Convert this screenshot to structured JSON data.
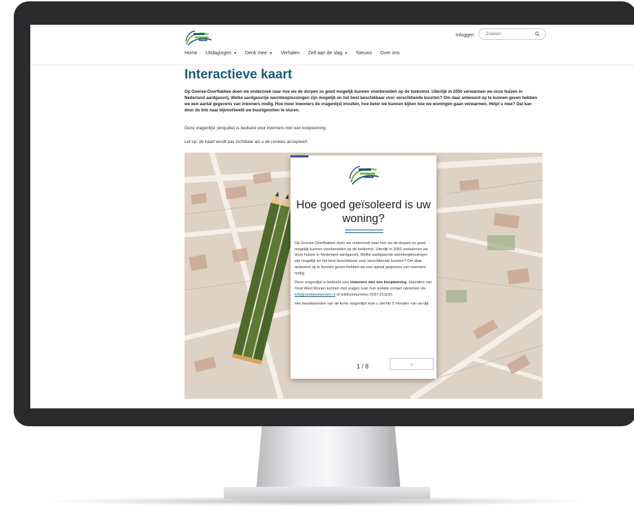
{
  "header": {
    "login_label": "Inloggen",
    "search_placeholder": "Zoeken"
  },
  "nav": {
    "items": [
      {
        "label": "Home",
        "dropdown": false
      },
      {
        "label": "Uitdagingen",
        "dropdown": true
      },
      {
        "label": "Denk mee",
        "dropdown": true
      },
      {
        "label": "Verhalen",
        "dropdown": false
      },
      {
        "label": "Zelf aan de slag",
        "dropdown": true
      },
      {
        "label": "Nieuws",
        "dropdown": false
      },
      {
        "label": "Over ons",
        "dropdown": false
      }
    ]
  },
  "page": {
    "title": "Interactieve kaart",
    "intro": "Op Goeree-Overflakkee doen we onderzoek naar hoe we de dorpen zo goed mogelijk kunnen voorbereiden op de toekomst. Uiterlijk in 2050 verwarmen we onze huizen in Nederland aardgasvrij. Welke aardgasvrije warmteoplossingen zijn mogelijk en het best beschikbaar voor verschillende buurten? Om daar antwoord op te kunnen geven hebben we een aantal gegevens van inwoners nodig. Hoe meer inwoners de vragenlijst invullen, hoe beter we kunnen kijken hoe we woningen gaan verwarmen. Helpt u mee? Dat kan door de link naar bijvoorbeeld uw buurtgenoten te sturen.",
    "note": "Deze vragenlijst (enquête) is bedoeld voor inwoners met een koopwoning.",
    "cookie_note": "Let op: de kaart wordt pas zichtbaar als u de cookies accepteert."
  },
  "card": {
    "title": "Hoe goed geïsoleerd is uw woning?",
    "p1": "Op Goeree-Overflakkee doen we onderzoek naar hoe we de dorpen zo goed mogelijk kunnen voorbereiden op de toekomst. Uiterlijk in 2050 verwarmen we onze huizen in Nederland aardgasvrij. Welke aardgasvrije warmteoplossingen zijn mogelijk en het best beschikbaar voor verschillende buurten? Om daar antwoord op te kunnen geven hebben we een aantal gegevens van inwoners nodig.",
    "p2_before": "Deze vragenlijst is bedoeld voor ",
    "p2_bold": "inwoners met een koopwoning",
    "p2_after": ". Huurders van Oost West Wonen kunnen met vragen over hun isolatie contact opnemen via ",
    "p2_link": "info@oostwestwonen.nl",
    "p2_end": " of telefoonnummer 0187-221100.",
    "p3": "Het beantwoorden van de korte vragenlijst kost u slechts 5 minuten van uw tijd.",
    "pager": "1 / 8",
    "next_label": ">"
  },
  "colors": {
    "brand_teal": "#1a5b73",
    "accent_blue": "#3b4aa0",
    "logo_green": "#7ab648",
    "bezel": "#2a2a2c"
  }
}
